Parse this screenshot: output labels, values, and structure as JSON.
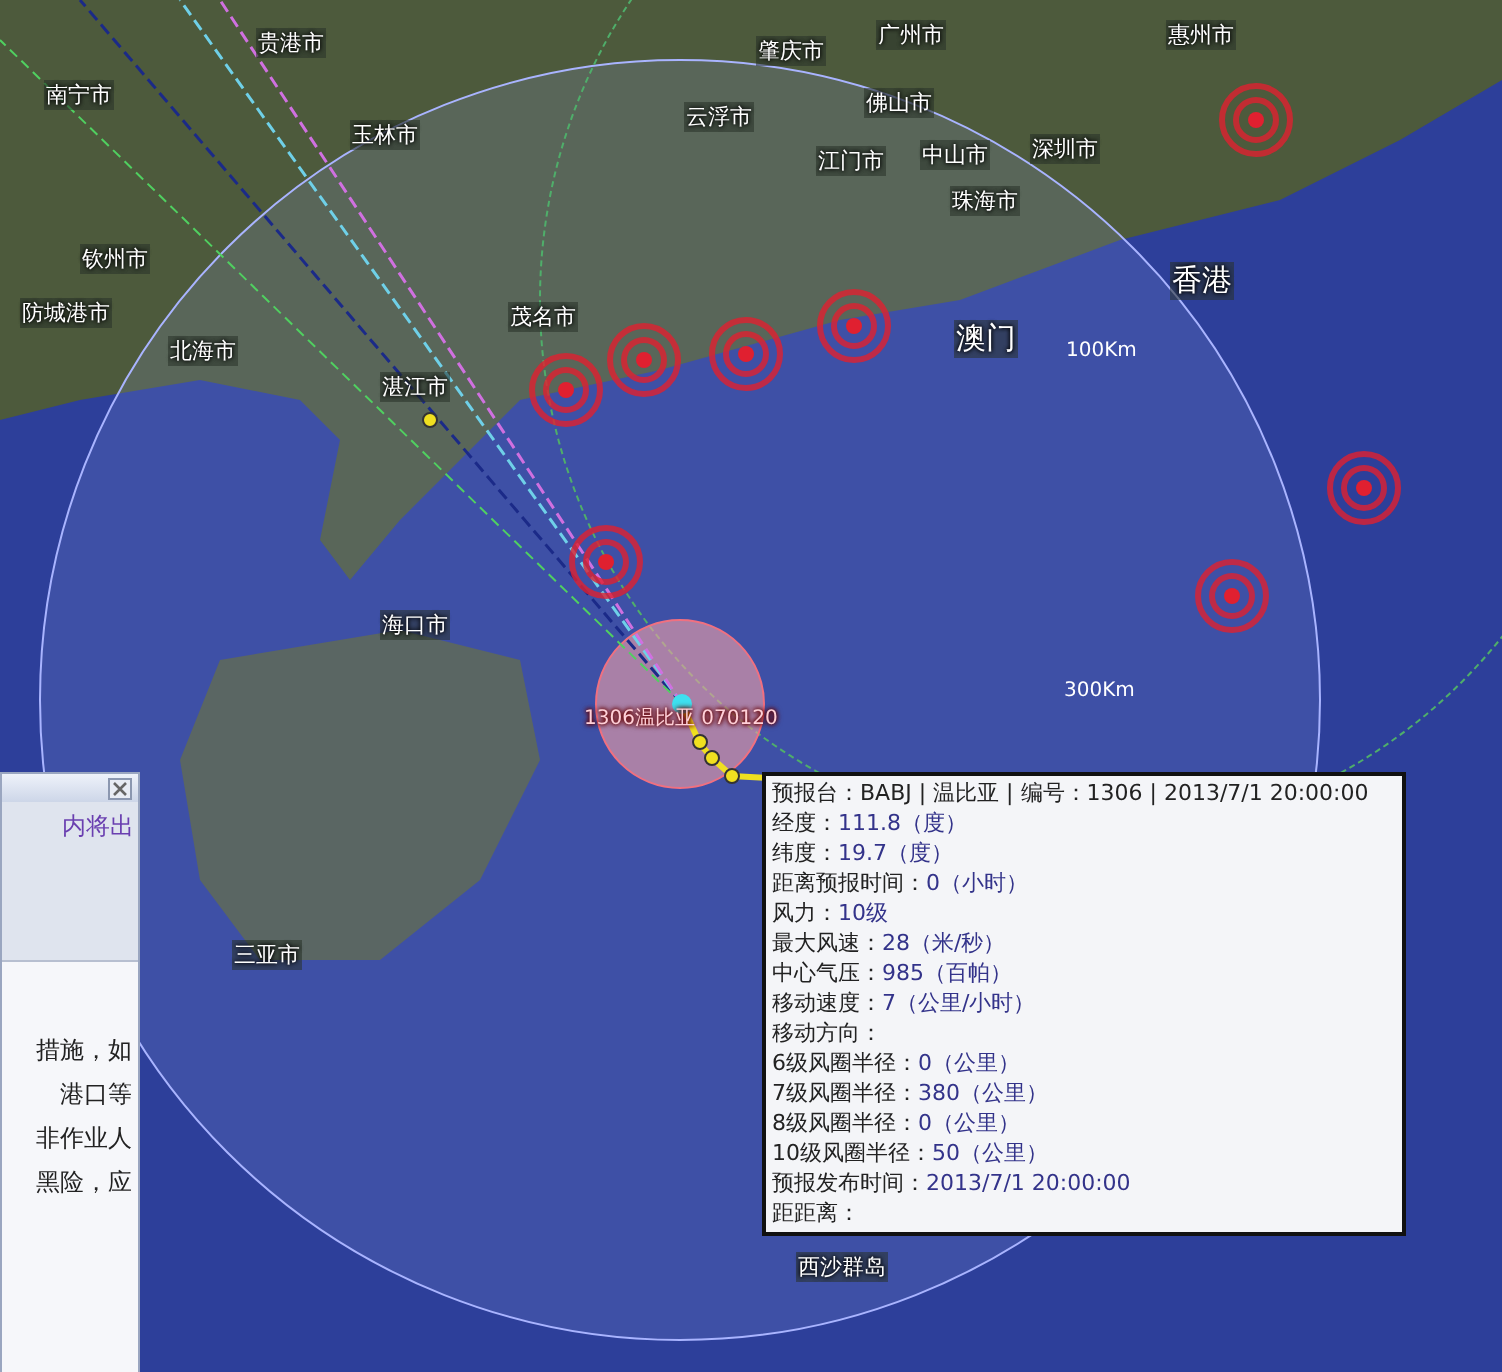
{
  "map": {
    "labels": [
      {
        "text": "贵港市"
      },
      {
        "text": "南宁市"
      },
      {
        "text": "肇庆市"
      },
      {
        "text": "广州市"
      },
      {
        "text": "惠州市"
      },
      {
        "text": "玉林市"
      },
      {
        "text": "云浮市"
      },
      {
        "text": "佛山市"
      },
      {
        "text": "江门市"
      },
      {
        "text": "中山市"
      },
      {
        "text": "深圳市"
      },
      {
        "text": "珠海市"
      },
      {
        "text": "香港"
      },
      {
        "text": "澳门"
      },
      {
        "text": "钦州市"
      },
      {
        "text": "防城港市"
      },
      {
        "text": "北海市"
      },
      {
        "text": "茂名市"
      },
      {
        "text": "湛江市"
      },
      {
        "text": "海口市"
      },
      {
        "text": "三亚市"
      },
      {
        "text": "西沙群岛"
      }
    ],
    "rings": [
      {
        "text": "100Km"
      },
      {
        "text": "300Km"
      }
    ],
    "typhoon_label": "1306温比亚 070120"
  },
  "side_panel": {
    "heading": "内将出",
    "lines": [
      "措施，如",
      "港口等",
      "非作业人",
      "黑险，应"
    ]
  },
  "tooltip": {
    "header": "预报台：BABJ | 温比亚 | 编号：1306 | 2013/7/1 20:00:00",
    "rows": [
      {
        "label": "经度：",
        "value": "111.8（度）"
      },
      {
        "label": "纬度：",
        "value": "19.7（度）"
      },
      {
        "label": "距离预报时间：",
        "value": "0（小时）"
      },
      {
        "label": "风力：",
        "value": "10级"
      },
      {
        "label": "最大风速：",
        "value": "28（米/秒）"
      },
      {
        "label": "中心气压：",
        "value": "985（百帕）"
      },
      {
        "label": "移动速度：",
        "value": "7（公里/小时）"
      },
      {
        "label": "移动方向："
      },
      {
        "label": "6级风圈半径：",
        "value": "0（公里）"
      },
      {
        "label": "7级风圈半径：",
        "value": "380（公里）"
      },
      {
        "label": "8级风圈半径：",
        "value": "0（公里）"
      },
      {
        "label": "10级风圈半径：",
        "value": "50（公里）"
      },
      {
        "label": "预报发布时间：",
        "value": "2013/7/1 20:00:00"
      },
      {
        "label": "距距离："
      }
    ]
  }
}
